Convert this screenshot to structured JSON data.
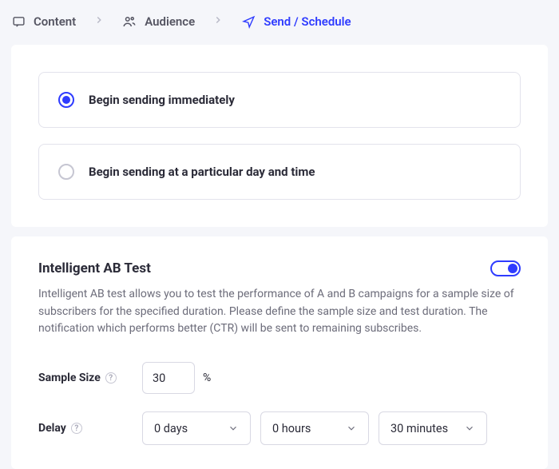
{
  "breadcrumb": {
    "steps": [
      {
        "label": "Content"
      },
      {
        "label": "Audience"
      },
      {
        "label": "Send / Schedule"
      }
    ]
  },
  "schedule": {
    "option_immediate": "Begin sending immediately",
    "option_scheduled": "Begin sending at a particular day and time"
  },
  "ab": {
    "title": "Intelligent AB Test",
    "description": "Intelligent AB test allows you to test the performance of A and B campaigns for a sample size of subscribers for the specified duration. Please define the sample size and test duration. The notification which performs better (CTR) will be sent to remaining subscribes.",
    "sample_label": "Sample Size",
    "sample_value": "30",
    "sample_unit": "%",
    "delay_label": "Delay",
    "delay_days": "0 days",
    "delay_hours": "0 hours",
    "delay_minutes": "30 minutes"
  }
}
